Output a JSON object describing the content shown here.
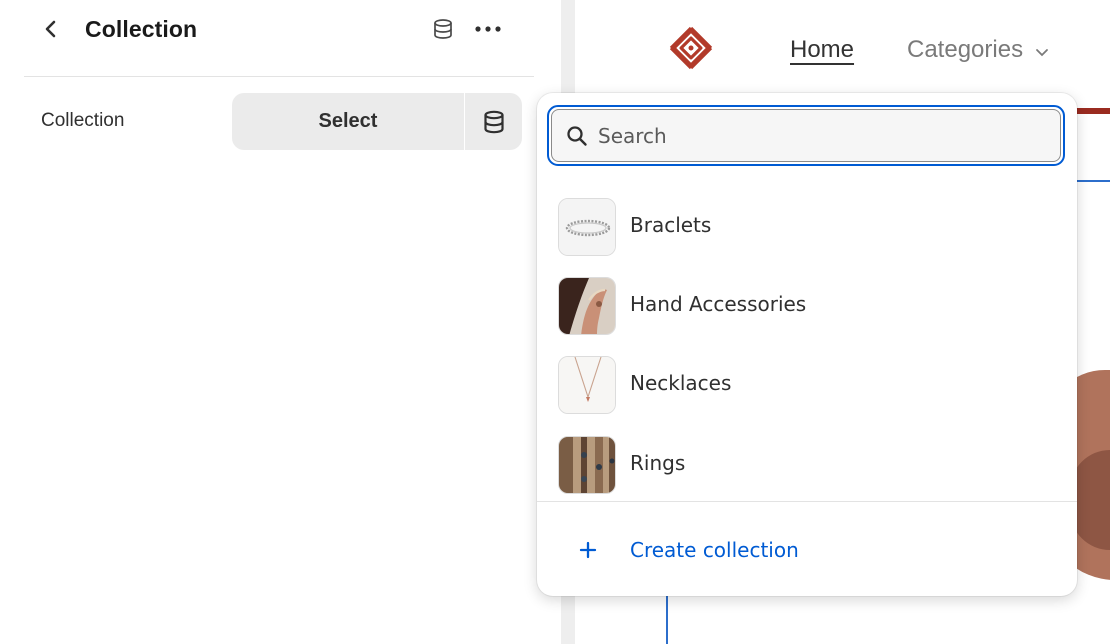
{
  "panel": {
    "title": "Collection",
    "icons": {
      "back": "chevron-left-icon",
      "source": "database-icon",
      "more": "more-horizontal-icon"
    },
    "field": {
      "label": "Collection",
      "select_label": "Select",
      "source_icon": "database-icon"
    }
  },
  "preview": {
    "logo_icon": "celtic-knot-logo",
    "nav": {
      "home": "Home",
      "categories": "Categories"
    },
    "colors": {
      "brand": "#9a2b20",
      "accent": "#2c6ecb"
    }
  },
  "picker": {
    "search": {
      "placeholder": "Search",
      "value": ""
    },
    "items": [
      {
        "label": "Braclets",
        "thumb": "bracelet-image"
      },
      {
        "label": "Hand Accessories",
        "thumb": "hand-accessories-image"
      },
      {
        "label": "Necklaces",
        "thumb": "necklace-image"
      },
      {
        "label": "Rings",
        "thumb": "rings-image"
      }
    ],
    "create_label": "Create collection",
    "colors": {
      "focus": "#005bd3",
      "link": "#005bd3"
    }
  }
}
